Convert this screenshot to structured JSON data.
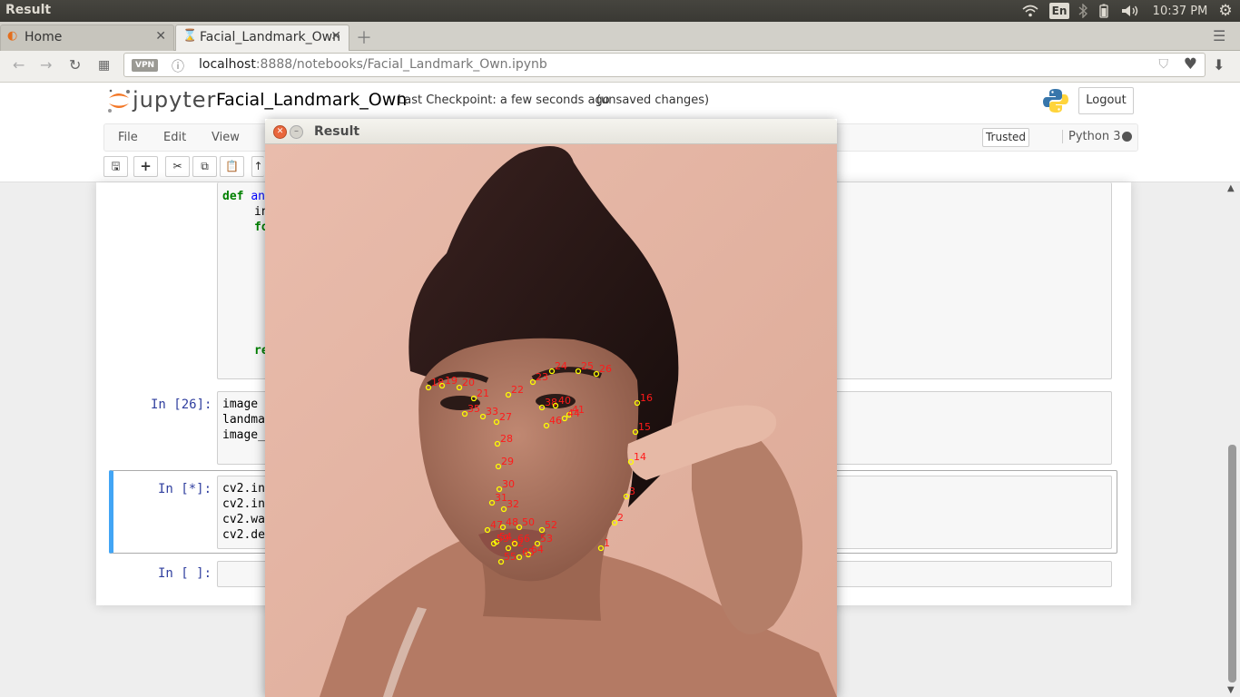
{
  "system_bar": {
    "window_title": "Result",
    "keyboard_layout": "En",
    "time": "10:37 PM",
    "icons": [
      "wifi-icon",
      "keyboard-layout-icon",
      "bluetooth-icon",
      "battery-icon",
      "volume-icon",
      "settings-gear-icon"
    ]
  },
  "browser": {
    "tabs": [
      {
        "label": "Home",
        "active": false,
        "icon": "jupyter-icon"
      },
      {
        "label": "Facial_Landmark_Own",
        "active": true,
        "icon": "hourglass-icon"
      }
    ],
    "vpn_badge": "VPN",
    "url_host": "localhost",
    "url_rest": ":8888/notebooks/Facial_Landmark_Own.ipynb"
  },
  "jupyter": {
    "logo_text": "jupyter",
    "notebook_name": "Facial_Landmark_Own",
    "checkpoint": "Last Checkpoint: a few seconds ago",
    "unsaved": "(unsaved changes)",
    "logout_label": "Logout",
    "menu": [
      "File",
      "Edit",
      "View"
    ],
    "trusted_label": "Trusted",
    "kernel_name": "Python 3"
  },
  "cells": {
    "c1": {
      "line1_kw": "def",
      "line1_fn": "an",
      "line2": "in",
      "line3_kw": "fo",
      "line4_kw": "re"
    },
    "c2": {
      "prompt": "In [26]:",
      "lines": [
        "image",
        "landma",
        "image_"
      ]
    },
    "c3": {
      "prompt": "In [*]:",
      "lines": [
        "cv2.in",
        "cv2.in",
        "cv2.wa",
        "cv2.de"
      ]
    },
    "c4": {
      "prompt": "In [ ]:"
    }
  },
  "result_window": {
    "title": "Result",
    "landmark_labels": [
      "1",
      "2",
      "3",
      "14",
      "15",
      "16",
      "18",
      "19",
      "20",
      "21",
      "22",
      "23",
      "24",
      "25",
      "26",
      "27",
      "28",
      "29",
      "30",
      "31",
      "32",
      "33",
      "35",
      "38",
      "40",
      "41",
      "44",
      "46",
      "47",
      "48",
      "50",
      "52",
      "53",
      "54",
      "55",
      "59",
      "62",
      "64",
      "65",
      "66"
    ]
  },
  "colors": {
    "accent_blue": "#42a5f5",
    "prompt_blue": "#303f9f",
    "landmark_red": "#ff1a1a",
    "landmark_yellow": "#ffff00",
    "jupyter_orange": "#e46e1d"
  }
}
